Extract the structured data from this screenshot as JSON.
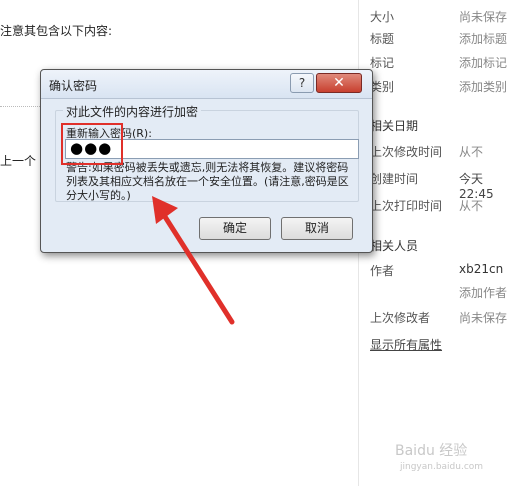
{
  "left": {
    "line1": "注意其包含以下内容:",
    "line2": "上一个"
  },
  "properties": {
    "rows": [
      {
        "label": "大小",
        "value": "尚未保存"
      },
      {
        "label": "标题",
        "value": "添加标题"
      },
      {
        "label": "标记",
        "value": "添加标记"
      },
      {
        "label": "类别",
        "value": "添加类别"
      }
    ],
    "dates_header": "相关日期",
    "dates": [
      {
        "label": "上次修改时间",
        "value": "从不"
      },
      {
        "label": "创建时间",
        "value": "今天 22:45"
      },
      {
        "label": "上次打印时间",
        "value": "从不"
      }
    ],
    "people_header": "相关人员",
    "author_label": "作者",
    "author_value": "xb21cn",
    "add_author": "添加作者",
    "last_modified_by_label": "上次修改者",
    "last_modified_by_value": "尚未保存",
    "show_all": "显示所有属性"
  },
  "dialog": {
    "title": "确认密码",
    "help": "?",
    "close": "✕",
    "group_title": "对此文件的内容进行加密",
    "input_label": "重新输入密码(R):",
    "password_mask": "●●●",
    "warning": "警告:如果密码被丢失或遗忘,则无法将其恢复。建议将密码列表及其相应文档名放在一个安全位置。(请注意,密码是区分大小写的。)",
    "ok": "确定",
    "cancel": "取消"
  },
  "watermark": {
    "line1": "Baidu 经验",
    "line2": "jingyan.baidu.com"
  },
  "colors": {
    "highlight": "#e0302a"
  }
}
